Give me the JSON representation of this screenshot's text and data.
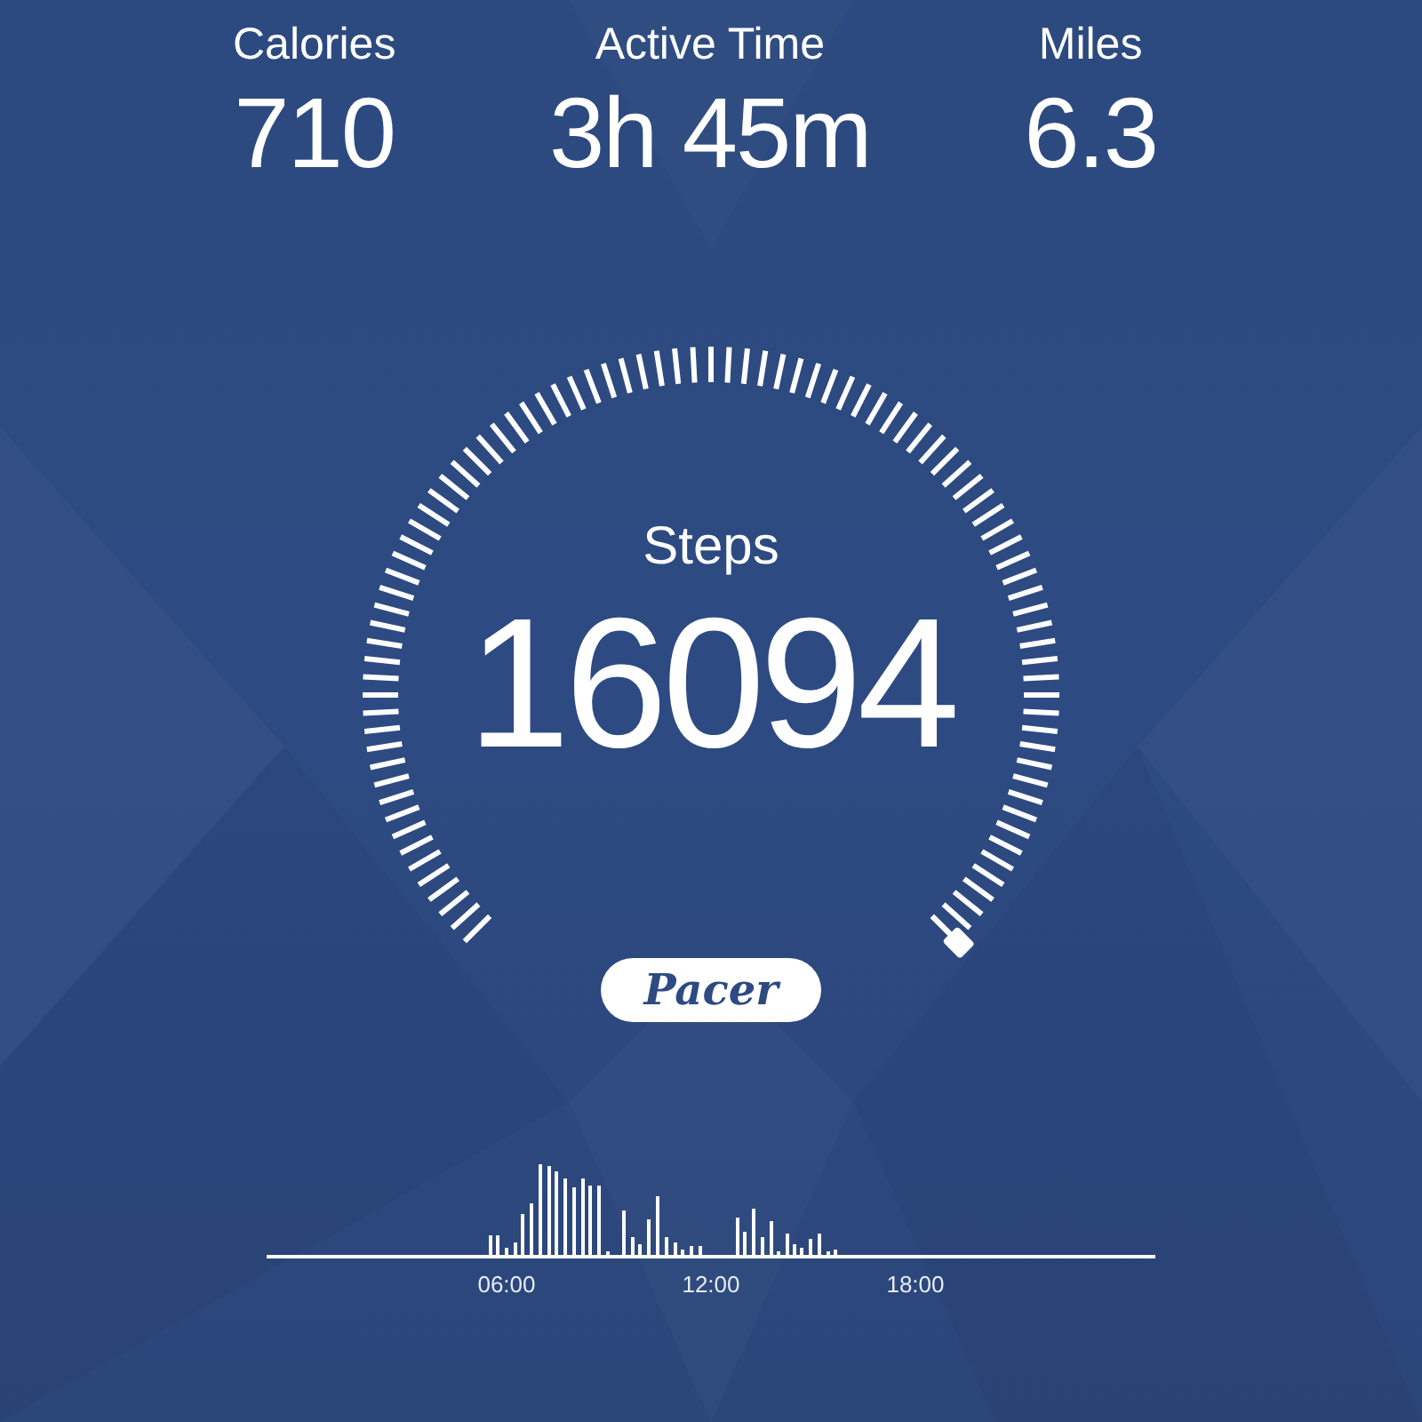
{
  "stats": [
    {
      "label": "Calories",
      "value": "710"
    },
    {
      "label": "Active Time",
      "value": "3h 45m"
    },
    {
      "label": "Miles",
      "value": "6.3"
    }
  ],
  "gauge": {
    "label": "Steps",
    "value": "16094"
  },
  "logo": "Pacer",
  "activity_chart": {
    "axis_labels": [
      "06:00",
      "12:00",
      "18:00"
    ]
  }
}
